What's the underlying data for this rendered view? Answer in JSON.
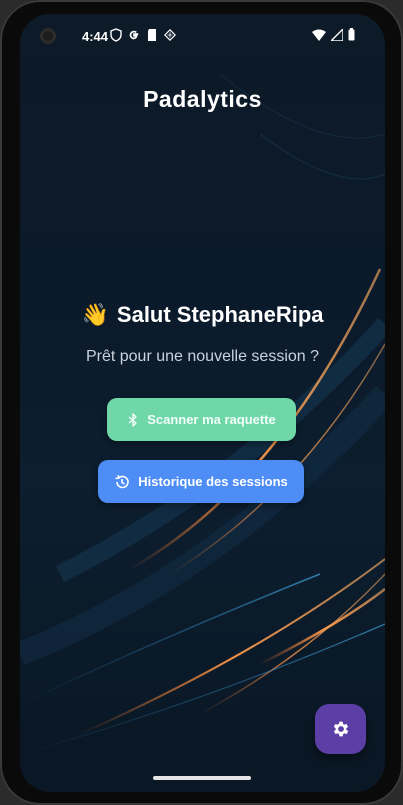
{
  "status_bar": {
    "time": "4:44",
    "left_icons": [
      "shield-icon",
      "google-g-icon",
      "sd-card-icon",
      "app-notification-icon"
    ],
    "right_icons": [
      "wifi-icon",
      "cellular-signal-icon",
      "battery-icon"
    ]
  },
  "app": {
    "title": "Padalytics"
  },
  "home": {
    "wave_emoji": "👋",
    "greeting": "Salut StephaneRipa",
    "subtitle": "Prêt pour une nouvelle session ?"
  },
  "actions": {
    "scan_label": "Scanner ma raquette",
    "scan_icon": "bluetooth-icon",
    "history_label": "Historique des sessions",
    "history_icon": "history-icon"
  },
  "fab": {
    "icon": "gear-icon"
  },
  "colors": {
    "background": "#0c1e2f",
    "scan_button": "#6fd7a8",
    "history_button": "#4d8df5",
    "fab": "#5b3fa6",
    "accent_streak": "#ff8a3d"
  }
}
